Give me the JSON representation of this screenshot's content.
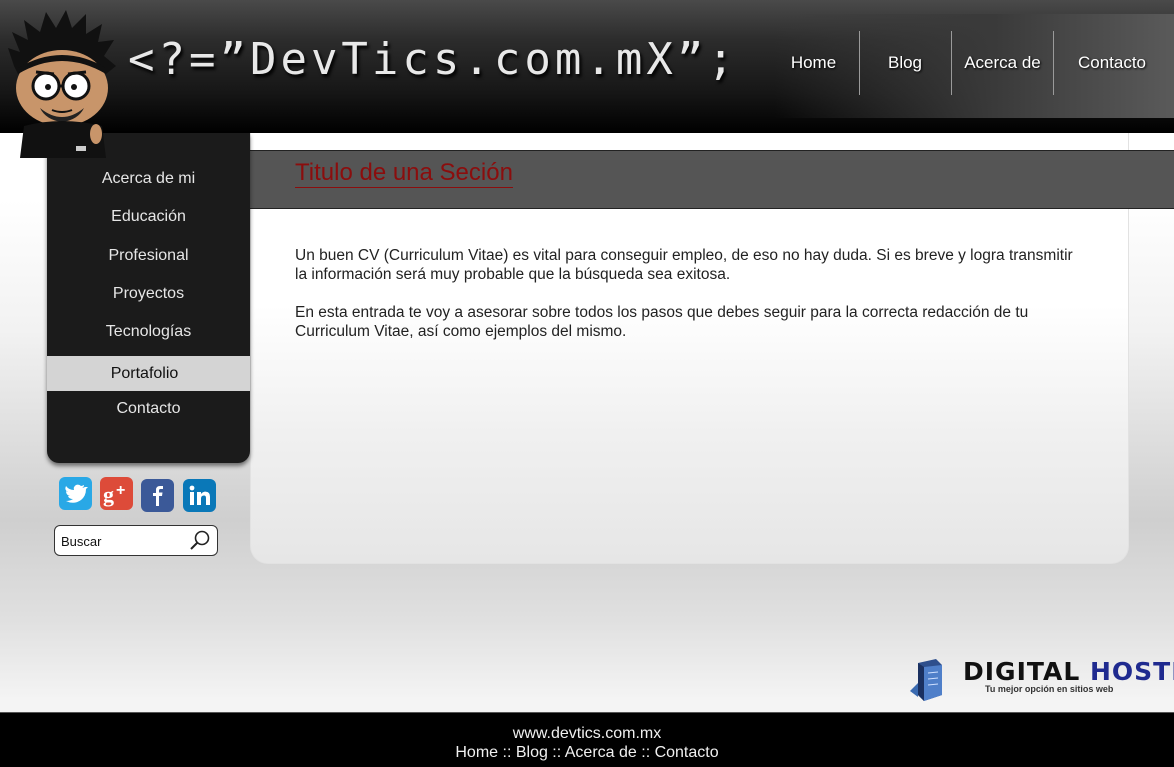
{
  "header": {
    "logo_text": "<?=”DevTics.com.mX”;",
    "nav": [
      "Home",
      "Blog",
      "Acerca de",
      "Contacto"
    ]
  },
  "sidebar": {
    "items": [
      {
        "label": "Acerca de mi",
        "active": false
      },
      {
        "label": "Educación",
        "active": false
      },
      {
        "label": "Profesional",
        "active": false
      },
      {
        "label": "Proyectos",
        "active": false
      },
      {
        "label": "Tecnologías",
        "active": false
      },
      {
        "label": "Portafolio",
        "active": true
      },
      {
        "label": "Contacto",
        "active": false
      }
    ]
  },
  "social": [
    "twitter-icon",
    "google-plus-icon",
    "facebook-icon",
    "linkedin-icon"
  ],
  "search": {
    "placeholder": "Buscar"
  },
  "main": {
    "section_title": "Titulo de una Seción",
    "paragraphs": [
      "Un buen CV (Curriculum Vitae) es vital para conseguir empleo, de eso no hay duda. Si es breve y logra transmitir la información será muy probable que la búsqueda sea exitosa.",
      "En esta entrada te voy a asesorar sobre todos los pasos que debes seguir para la correcta redacción de tu Curriculum Vitae, así como ejemplos del mismo."
    ]
  },
  "sponsor": {
    "word1": "DIGITAL",
    "word2": "HOSTING",
    "tagline": "Tu mejor opción en sitios web"
  },
  "footer": {
    "site": "www.devtics.com.mx",
    "links": "Home :: Blog :: Acerca de :: Contacto"
  },
  "colors": {
    "title_red": "#8b0d0d",
    "hosting_blue": "#1f2a8f"
  }
}
